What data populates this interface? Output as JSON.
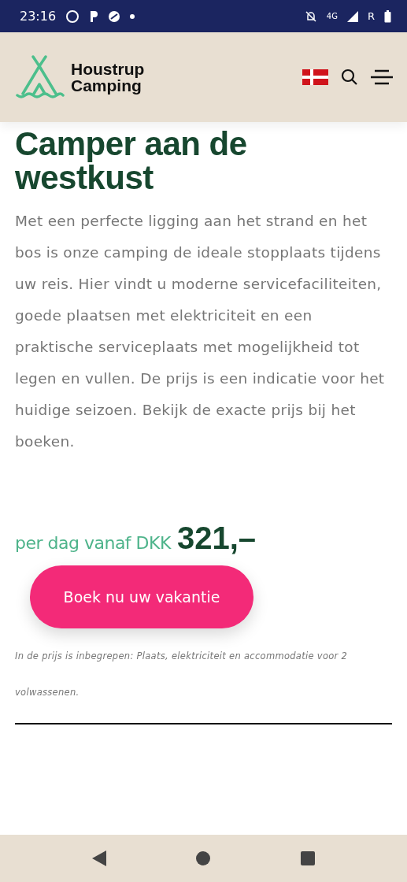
{
  "status_bar": {
    "time": "23:16",
    "network": "4G",
    "roaming": "R"
  },
  "header": {
    "logo_line_1": "Houstrup",
    "logo_line_2": "Camping"
  },
  "title": "Camper aan de westkust",
  "description": "Met een perfecte ligging aan het strand en het bos is onze camping de ideale stopplaats tijdens uw reis. Hier vindt u moderne servicefaciliteiten, goede plaatsen met elektriciteit en een praktische serviceplaats met mogelijkheid tot legen en vullen. De prijs is een indicatie voor het huidige seizoen. Bekijk de exacte prijs bij het boeken.",
  "price": {
    "label": "per dag vanaf DKK",
    "amount": "321,–"
  },
  "book_button": "Boek nu uw vakantie",
  "note": "In de prijs is inbegrepen: Plaats, elektriciteit en accommodatie voor 2 volwassenen."
}
